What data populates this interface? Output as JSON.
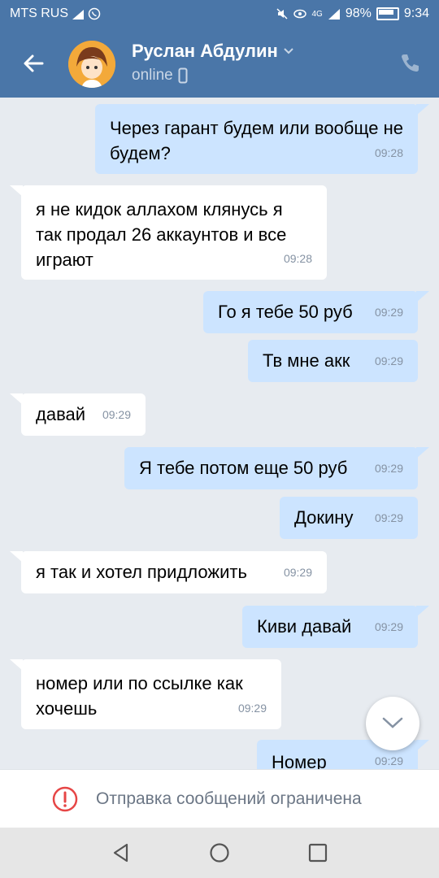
{
  "status_bar": {
    "carrier": "MTS RUS",
    "battery": "98%",
    "time": "9:34",
    "network": "4G"
  },
  "header": {
    "name": "Руслан Абдулин",
    "status": "online",
    "back_icon": "arrow-left-icon",
    "call_icon": "phone-icon",
    "colors": {
      "bar": "#4a76a8"
    }
  },
  "messages": [
    {
      "dir": "out",
      "text": "Через гарант будем или вообще не будем?",
      "time": "09:28"
    },
    {
      "dir": "in",
      "text": "я не кидок аллахом клянусь я так продал 26 аккаунтов и все играют",
      "time": "09:28"
    },
    {
      "dir": "out",
      "text": "Го я тебе 50 руб",
      "time": "09:29"
    },
    {
      "dir": "out",
      "text": "Тв мне акк",
      "time": "09:29"
    },
    {
      "dir": "in",
      "text": "давай",
      "time": "09:29"
    },
    {
      "dir": "out",
      "text": "Я тебе потом еще 50 руб",
      "time": "09:29"
    },
    {
      "dir": "out",
      "text": "Докину",
      "time": "09:29"
    },
    {
      "dir": "in",
      "text": "я так и хотел придложить",
      "time": "09:29"
    },
    {
      "dir": "out",
      "text": "Киви давай",
      "time": "09:29"
    },
    {
      "dir": "in",
      "text": "номер или по ссылке как хочешь",
      "time": "09:29"
    },
    {
      "dir": "out",
      "text": "Номер",
      "time": "09:29"
    }
  ],
  "restriction": {
    "text": "Отправка сообщений ограничена",
    "icon": "warning-circle-icon"
  },
  "navbar": {
    "back_icon": "triangle-back-icon",
    "home_icon": "circle-home-icon",
    "recents_icon": "square-recents-icon"
  }
}
